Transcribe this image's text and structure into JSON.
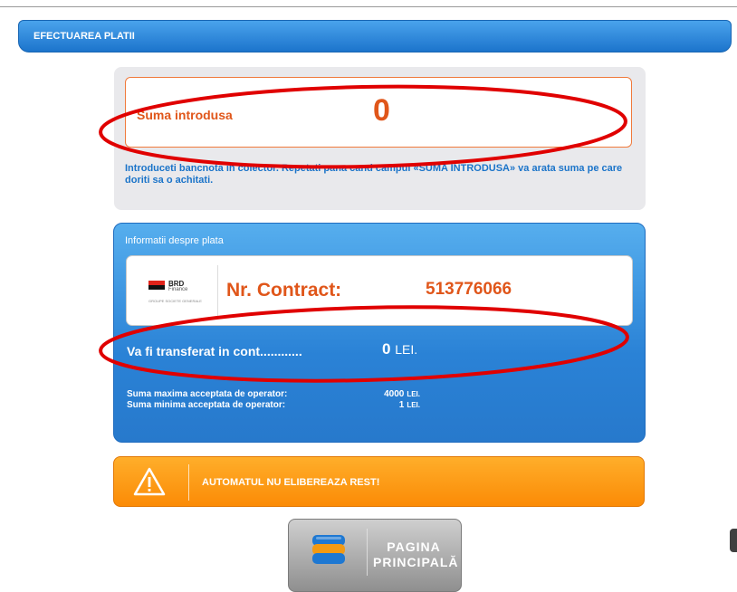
{
  "header": {
    "title": "EFECTUAREA PLATII"
  },
  "payment_sum": {
    "label": "Suma introdusa",
    "value": "0",
    "instructions": "Introduceti bancnota in colector. Repetati pana cand campul «SUMA INTRODUSA» va arata suma pe care doriti sa o achitati."
  },
  "payment_info": {
    "title": "Informatii despre plata",
    "provider_logo": {
      "name": "BRD",
      "subtitle": "Finance",
      "tagline": "GROUPE SOCIETE GENERALE"
    },
    "contract_label": "Nr. Contract:",
    "contract_number": "513776066",
    "transfer_label": "Va fi transferat in cont............",
    "transfer_amount": "0",
    "transfer_currency": "LEI.",
    "max_label": "Suma maxima acceptata de operator:",
    "max_value": "4000",
    "max_currency": "LEI.",
    "min_label": "Suma minima acceptata de operator:",
    "min_value": "1",
    "min_currency": "LEI."
  },
  "warning": {
    "icon": "warning-triangle-icon",
    "text": "AUTOMATUL NU ELIBEREAZA REST!"
  },
  "home_button": {
    "icon": "home-stack-icon",
    "line1": "PAGINA",
    "line2": "PRINCIPALĂ"
  },
  "colors": {
    "header_blue": "#2a82d6",
    "accent_orange": "#e0561a",
    "warning_orange": "#fb8b06",
    "annotation_red": "#e00000"
  }
}
